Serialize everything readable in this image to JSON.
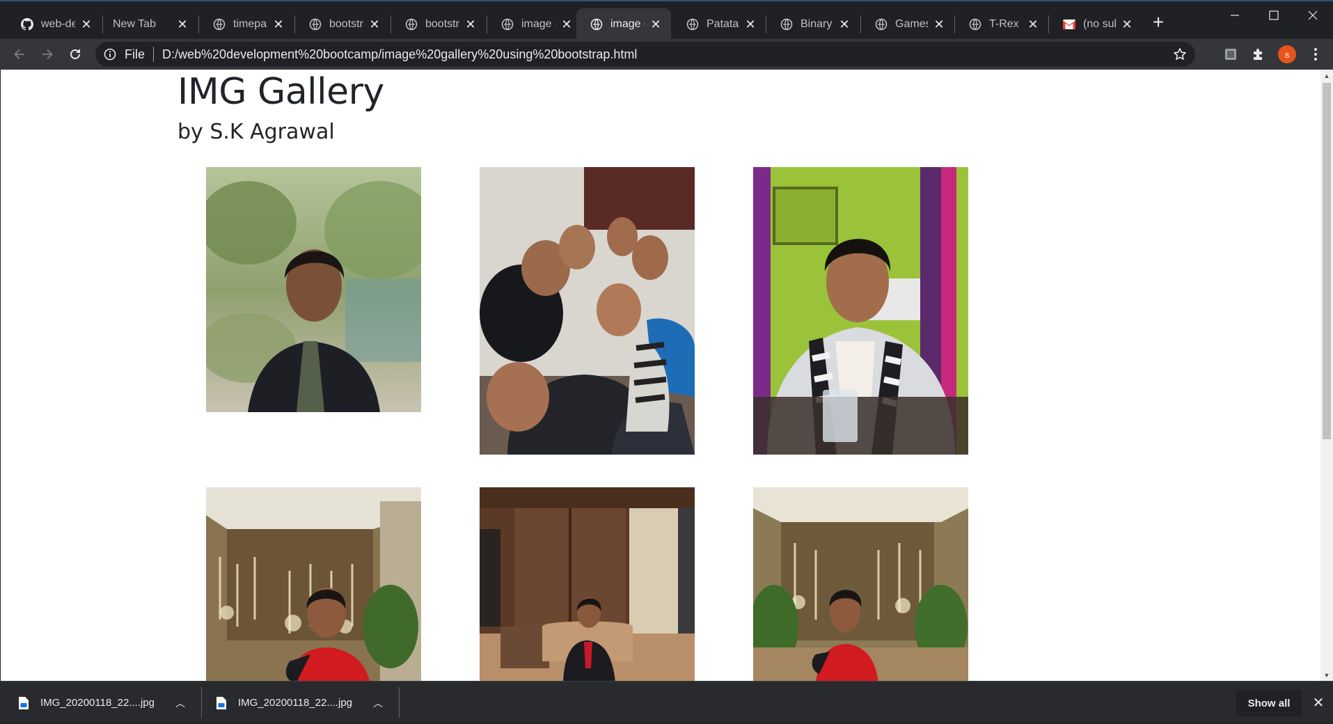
{
  "window": {
    "minimize_icon": "minimize-icon",
    "maximize_icon": "maximize-icon",
    "close_icon": "close-icon"
  },
  "tabs": [
    {
      "label": "web-dev",
      "icon": "github-icon",
      "active": false
    },
    {
      "label": "New Tab",
      "icon": "",
      "active": false
    },
    {
      "label": "timepas",
      "icon": "globe-icon",
      "active": false
    },
    {
      "label": "bootstra",
      "icon": "globe-icon",
      "active": false
    },
    {
      "label": "bootstra",
      "icon": "globe-icon",
      "active": false
    },
    {
      "label": "image g",
      "icon": "globe-icon",
      "active": false
    },
    {
      "label": "image g",
      "icon": "globe-icon",
      "active": true
    },
    {
      "label": "Patatap",
      "icon": "globe-icon",
      "active": false
    },
    {
      "label": "Binary C",
      "icon": "globe-icon",
      "active": false
    },
    {
      "label": "Games",
      "icon": "globe-icon",
      "active": false
    },
    {
      "label": "T-Rex G",
      "icon": "globe-icon",
      "active": false
    },
    {
      "label": "(no subj",
      "icon": "gmail-icon",
      "active": false
    }
  ],
  "toolbar": {
    "scheme_label": "File",
    "url": "D:/web%20development%20bootcamp/image%20gallery%20using%20bootstrap.html",
    "avatar_letter": "s"
  },
  "page": {
    "title": "IMG Gallery",
    "subtitle": "by S.K Agrawal",
    "photos": [
      {
        "alt": "Portrait in dark suit with palm trees"
      },
      {
        "alt": "Group selfie of five friends"
      },
      {
        "alt": "Selfie in striped sweater at table"
      },
      {
        "alt": "Standing in red shirt in hotel lobby"
      },
      {
        "alt": "Seated on sofa in hotel lobby"
      },
      {
        "alt": "Standing in red shirt near plants"
      }
    ]
  },
  "downloads": {
    "items": [
      {
        "filename": "IMG_20200118_22....jpg"
      },
      {
        "filename": "IMG_20200118_22....jpg"
      }
    ],
    "show_all_label": "Show all"
  },
  "colors": {
    "chrome_dark": "#202124",
    "toolbar": "#35363a",
    "page_bg": "#ffffff",
    "text": "#212529",
    "avatar": "#e8541c"
  }
}
